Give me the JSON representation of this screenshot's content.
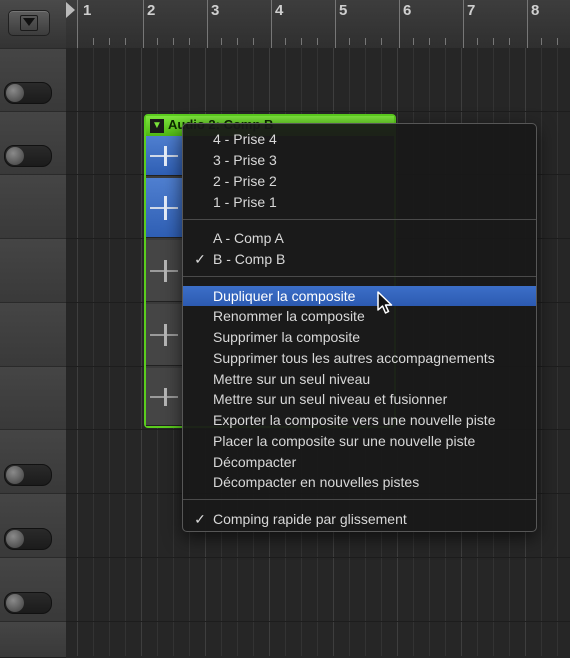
{
  "ruler": {
    "bars": [
      "1",
      "2",
      "3",
      "4",
      "5",
      "6",
      "7",
      "8"
    ]
  },
  "region": {
    "title": "Audio 2: Comp B",
    "collapse_glyph": "▼"
  },
  "menu": {
    "takes": [
      "4 - Prise 4",
      "3 - Prise 3",
      "2 - Prise 2",
      "1 - Prise 1"
    ],
    "comps": [
      {
        "label": "A - Comp A",
        "checked": false
      },
      {
        "label": "B - Comp B",
        "checked": true
      }
    ],
    "actions": [
      {
        "label": "Dupliquer la composite",
        "highlighted": true
      },
      {
        "label": "Renommer la composite"
      },
      {
        "label": "Supprimer la composite"
      },
      {
        "label": "Supprimer tous les autres accompagnements"
      },
      {
        "label": "Mettre sur un seul niveau"
      },
      {
        "label": "Mettre sur un seul niveau et fusionner"
      },
      {
        "label": "Exporter la composite vers une nouvelle piste"
      },
      {
        "label": "Placer la composite sur une nouvelle piste"
      },
      {
        "label": "Décompacter"
      },
      {
        "label": "Décompacter en nouvelles pistes"
      }
    ],
    "quick_swipe": {
      "label": "Comping rapide par glissement",
      "checked": true
    },
    "check_glyph": "✓"
  },
  "colors": {
    "region_green": "#5bcd1e",
    "highlight_blue": "#2c5ab1",
    "take_blue": "#3a68be"
  }
}
